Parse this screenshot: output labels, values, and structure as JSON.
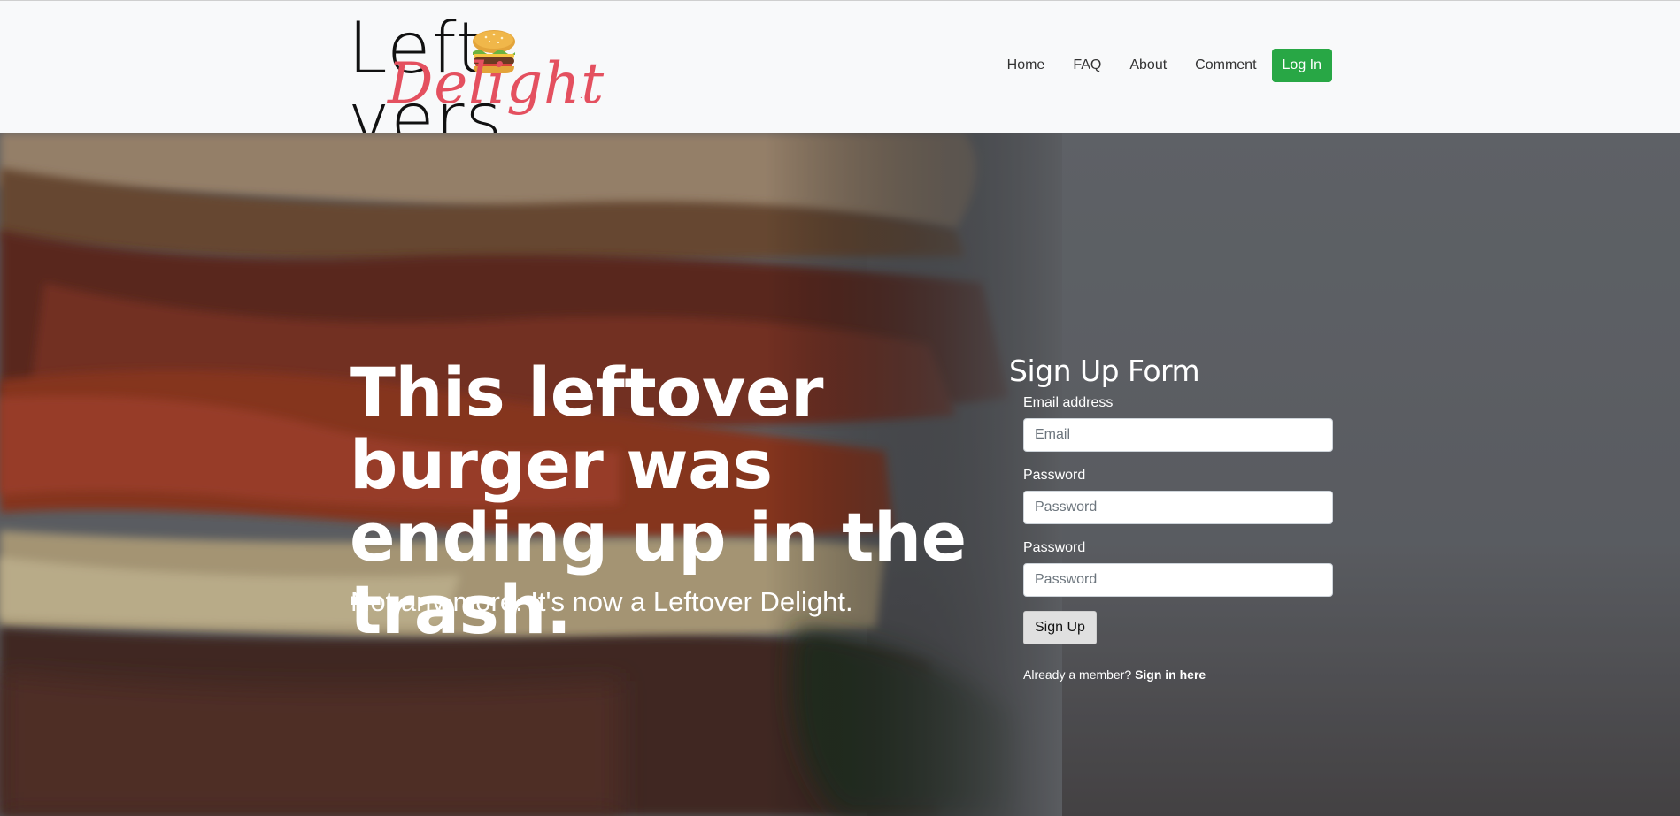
{
  "brand": {
    "word1": "Leftovers",
    "word2": "Delight",
    "mark": ".",
    "logo_icon": "burger-icon"
  },
  "nav": {
    "items": [
      "Home",
      "FAQ",
      "About",
      "Comment"
    ],
    "login_label": "Log In"
  },
  "hero": {
    "headline": "This leftover burger was ending up in the trash.",
    "subline": "Not any more. It's now a Leftover Delight."
  },
  "form": {
    "title": "Sign Up Form",
    "email_label": "Email address",
    "email_placeholder": "Email",
    "password_label": "Password",
    "password_placeholder": "Password",
    "confirm_label": "Password",
    "confirm_placeholder": "Password",
    "submit_label": "Sign Up",
    "member_text": "Already a member?",
    "member_link": "Sign in here"
  },
  "colors": {
    "accent_green": "#28a745",
    "brand_pink": "#e4505f"
  }
}
